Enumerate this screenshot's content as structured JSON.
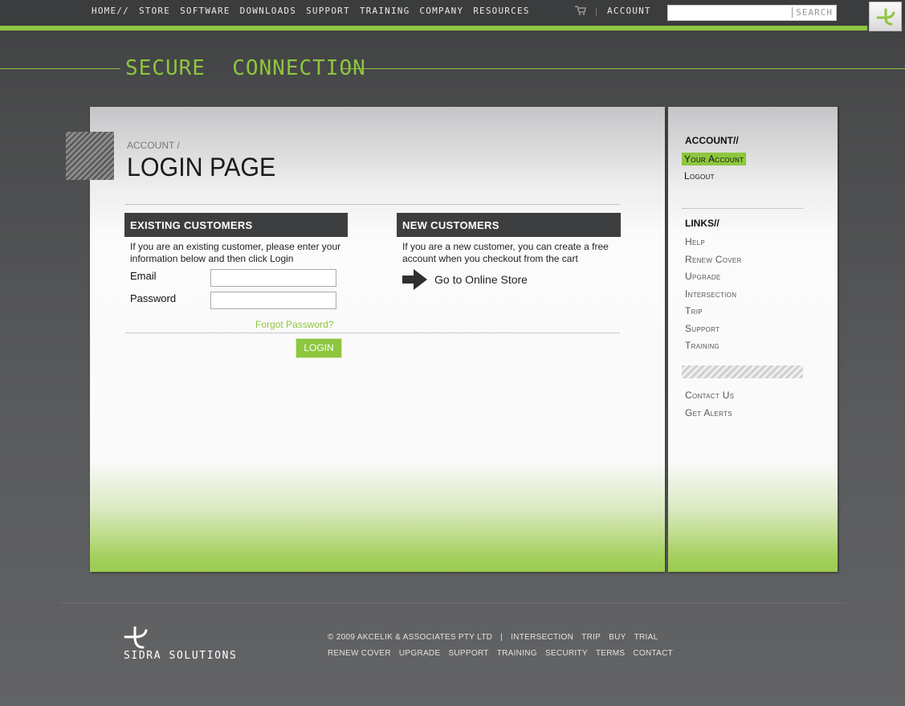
{
  "nav": {
    "items": [
      "HOME//",
      "STORE",
      "SOFTWARE",
      "DOWNLOADS",
      "SUPPORT",
      "TRAINING",
      "COMPANY",
      "RESOURCES"
    ],
    "account": "ACCOUNT",
    "separator": "|",
    "search_placeholder": "",
    "search_button": "SEARCH"
  },
  "header": {
    "title": "SECURE  CONNECTION"
  },
  "main": {
    "breadcrumb": "ACCOUNT /",
    "page_title": "LOGIN PAGE",
    "existing": {
      "heading": "EXISTING CUSTOMERS",
      "text": "If you are an existing customer, please enter your information below and then click Login",
      "email_label": "Email",
      "password_label": "Password",
      "email_value": "",
      "password_value": "",
      "forgot": "Forgot Password?",
      "login_button": "LOGIN"
    },
    "new": {
      "heading": "NEW CUSTOMERS",
      "text": "If you are a new customer, you can create a free account when you checkout from the cart",
      "store_link": "Go to Online Store"
    }
  },
  "sidebar": {
    "account_heading": "ACCOUNT//",
    "account_items": [
      "Your Account",
      "Logout"
    ],
    "links_heading": "LINKS//",
    "links_items": [
      "Help",
      "Renew Cover",
      "Upgrade",
      "Intersection",
      "Trip",
      "Support",
      "Training"
    ],
    "contact_items": [
      "Contact Us",
      "Get Alerts"
    ]
  },
  "footer": {
    "brand": "SIDRA SOLUTIONS",
    "copyright": "© 2009 AKCELIK & ASSOCIATES PTY LTD",
    "separator": "|",
    "row1": [
      "INTERSECTION",
      "TRIP",
      "BUY",
      "TRIAL"
    ],
    "row2": [
      "RENEW COVER",
      "UPGRADE",
      "SUPPORT",
      "TRAINING",
      "SECURITY",
      "TERMS",
      "CONTACT"
    ]
  },
  "colors": {
    "accent": "#8dc63f",
    "dark": "#3d3e3f"
  }
}
